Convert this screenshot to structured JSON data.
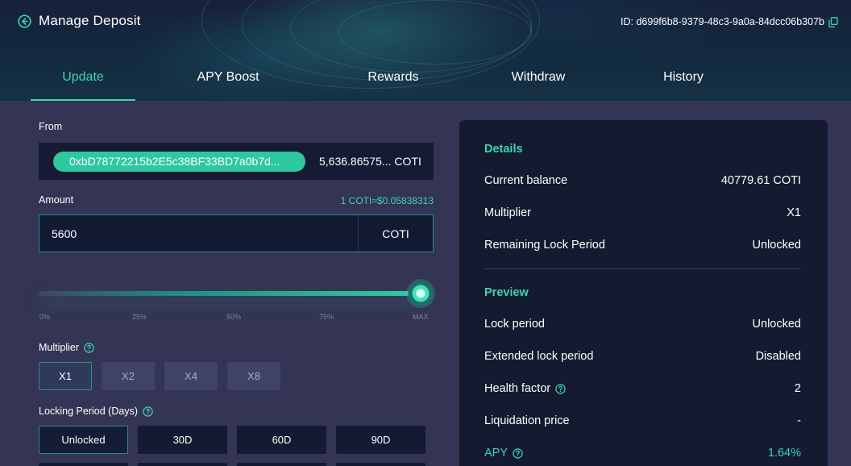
{
  "header": {
    "title": "Manage Deposit",
    "id_text": "ID: d699f6b8-9379-48c3-9a0a-84dcc06b307b",
    "back_icon": "back-arrow-icon",
    "copy_icon": "copy-icon"
  },
  "tabs": [
    {
      "label": "Update",
      "active": true
    },
    {
      "label": "APY Boost",
      "active": false
    },
    {
      "label": "Rewards",
      "active": false
    },
    {
      "label": "Withdraw",
      "active": false
    },
    {
      "label": "History",
      "active": false
    }
  ],
  "form": {
    "from_label": "From",
    "from_address": "0xbD78772215b2E5c38BF33BD7a0b7d...",
    "from_balance": "5,636.86575... COTI",
    "amount_label": "Amount",
    "rate": "1 COTI≈$0.05838313",
    "amount_value": "5600",
    "amount_unit": "COTI",
    "slider_level": 1.0,
    "slider_ticks": [
      "0%",
      "25%",
      "50%",
      "75%",
      "MAX"
    ],
    "multiplier_label": "Multiplier",
    "multipliers": [
      "X1",
      "X2",
      "X4",
      "X8"
    ],
    "multiplier_selected": "X1",
    "locking_label": "Locking Period (Days)",
    "lock_periods": [
      "Unlocked",
      "30D",
      "60D",
      "90D"
    ],
    "lock_selected": "Unlocked"
  },
  "details": {
    "title": "Details",
    "rows": [
      {
        "label": "Current balance",
        "value": "40779.61 COTI"
      },
      {
        "label": "Multiplier",
        "value": "X1"
      },
      {
        "label": "Remaining Lock Period",
        "value": "Unlocked"
      }
    ]
  },
  "preview": {
    "title": "Preview",
    "rows": [
      {
        "label": "Lock period",
        "value": "Unlocked"
      },
      {
        "label": "Extended lock period",
        "value": "Disabled"
      },
      {
        "label": "Health factor",
        "value": "2"
      },
      {
        "label": "Liquidation price",
        "value": "-"
      },
      {
        "label": "APY",
        "value": "1.64%"
      }
    ]
  },
  "colors": {
    "accent": "#3fd4b0",
    "panel": "#141a30",
    "background": "#343454"
  }
}
